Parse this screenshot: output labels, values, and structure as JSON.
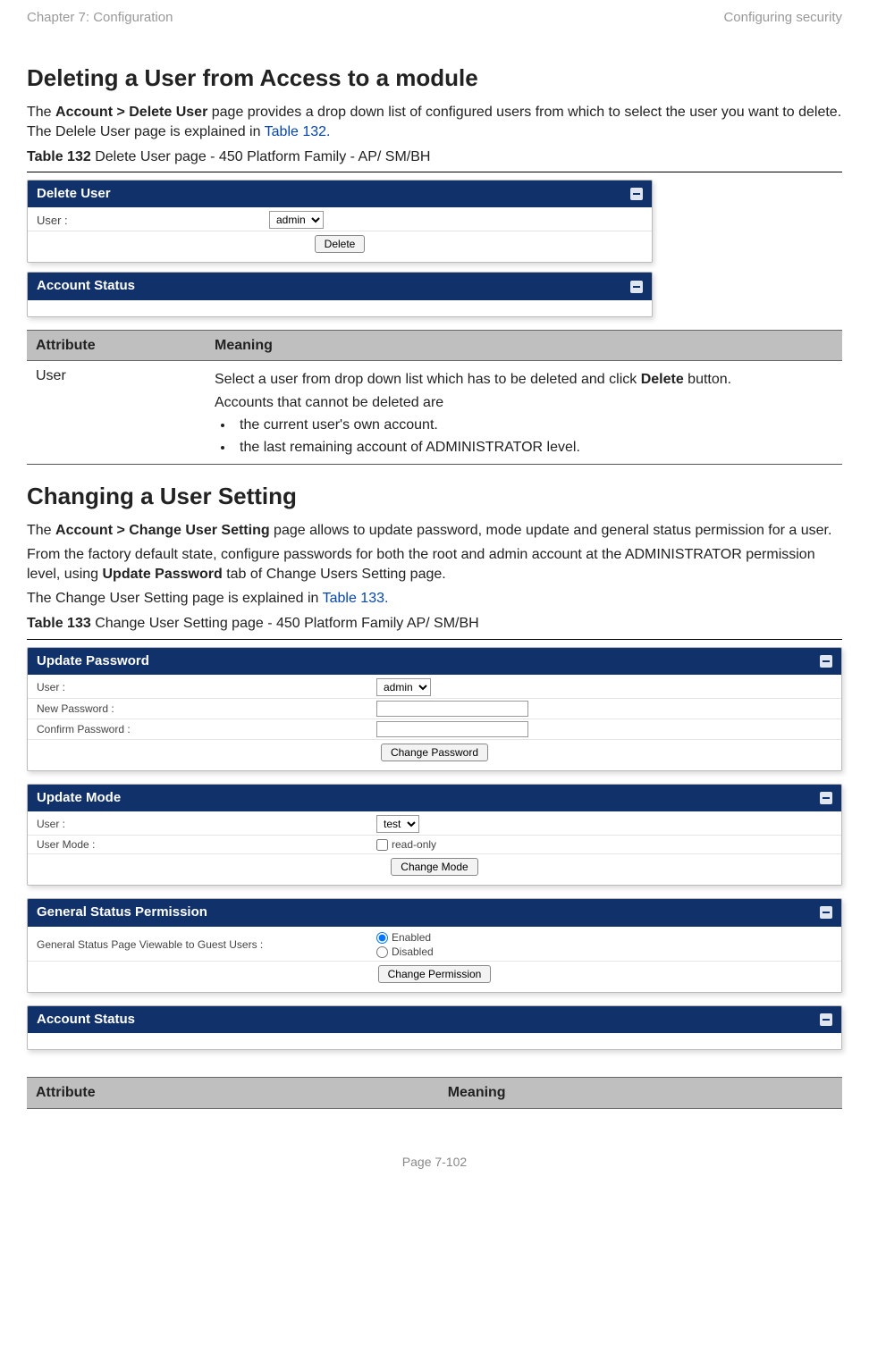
{
  "header": {
    "left": "Chapter 7:  Configuration",
    "right": "Configuring security"
  },
  "section1": {
    "title": "Deleting a User from Access to a module",
    "intro_a": "The ",
    "intro_b_bold": "Account > Delete User",
    "intro_c": " page provides a drop down list of configured users from which to select the user you want to delete. The Delele User page is explained in ",
    "intro_link": "Table 132.",
    "caption_bold": "Table 132",
    "caption_rest": " Delete User page - 450 Platform Family - AP/ SM/BH"
  },
  "shot1": {
    "panel1_title": "Delete User",
    "user_label": "User :",
    "user_option": "admin",
    "delete_btn": "Delete",
    "panel2_title": "Account Status"
  },
  "table1": {
    "h1": "Attribute",
    "h2": "Meaning",
    "row_attr": "User",
    "row_m1a": "Select a user from drop down list which has to be deleted and click ",
    "row_m1b_bold": "Delete",
    "row_m1c": " button.",
    "row_m2": "Accounts that cannot be deleted are",
    "row_li1": "the current user's own account.",
    "row_li2": "the last remaining account of ADMINISTRATOR level."
  },
  "section2": {
    "title": "Changing a User Setting",
    "p1a": "The ",
    "p1b_bold": "Account > Change User Setting",
    "p1c": " page allows to update password, mode update and general status permission for a user.",
    "p2a": "From the factory default state, configure passwords for both the root and admin account at the ADMINISTRATOR permission level, using ",
    "p2b_bold": "Update Password",
    "p2c": " tab of Change Users Setting page.",
    "p3a": "The Change User Setting page is explained in ",
    "p3_link": "Table 133.",
    "caption_bold": "Table 133",
    "caption_rest": " Change User Setting page - 450 Platform Family AP/ SM/BH"
  },
  "shot2": {
    "up_title": "Update Password",
    "up_user_label": "User :",
    "up_user_opt": "admin",
    "up_np_label": "New Password :",
    "up_cp_label": "Confirm Password :",
    "up_btn": "Change Password",
    "um_title": "Update Mode",
    "um_user_label": "User :",
    "um_user_opt": "test",
    "um_mode_label": "User Mode :",
    "um_mode_val": "read-only",
    "um_btn": "Change Mode",
    "gs_title": "General Status Permission",
    "gs_label": "General Status Page Viewable to Guest Users :",
    "gs_en": "Enabled",
    "gs_dis": "Disabled",
    "gs_btn": "Change Permission",
    "as_title": "Account Status"
  },
  "table2": {
    "h1": "Attribute",
    "h2": "Meaning"
  },
  "footer": "Page 7-102"
}
